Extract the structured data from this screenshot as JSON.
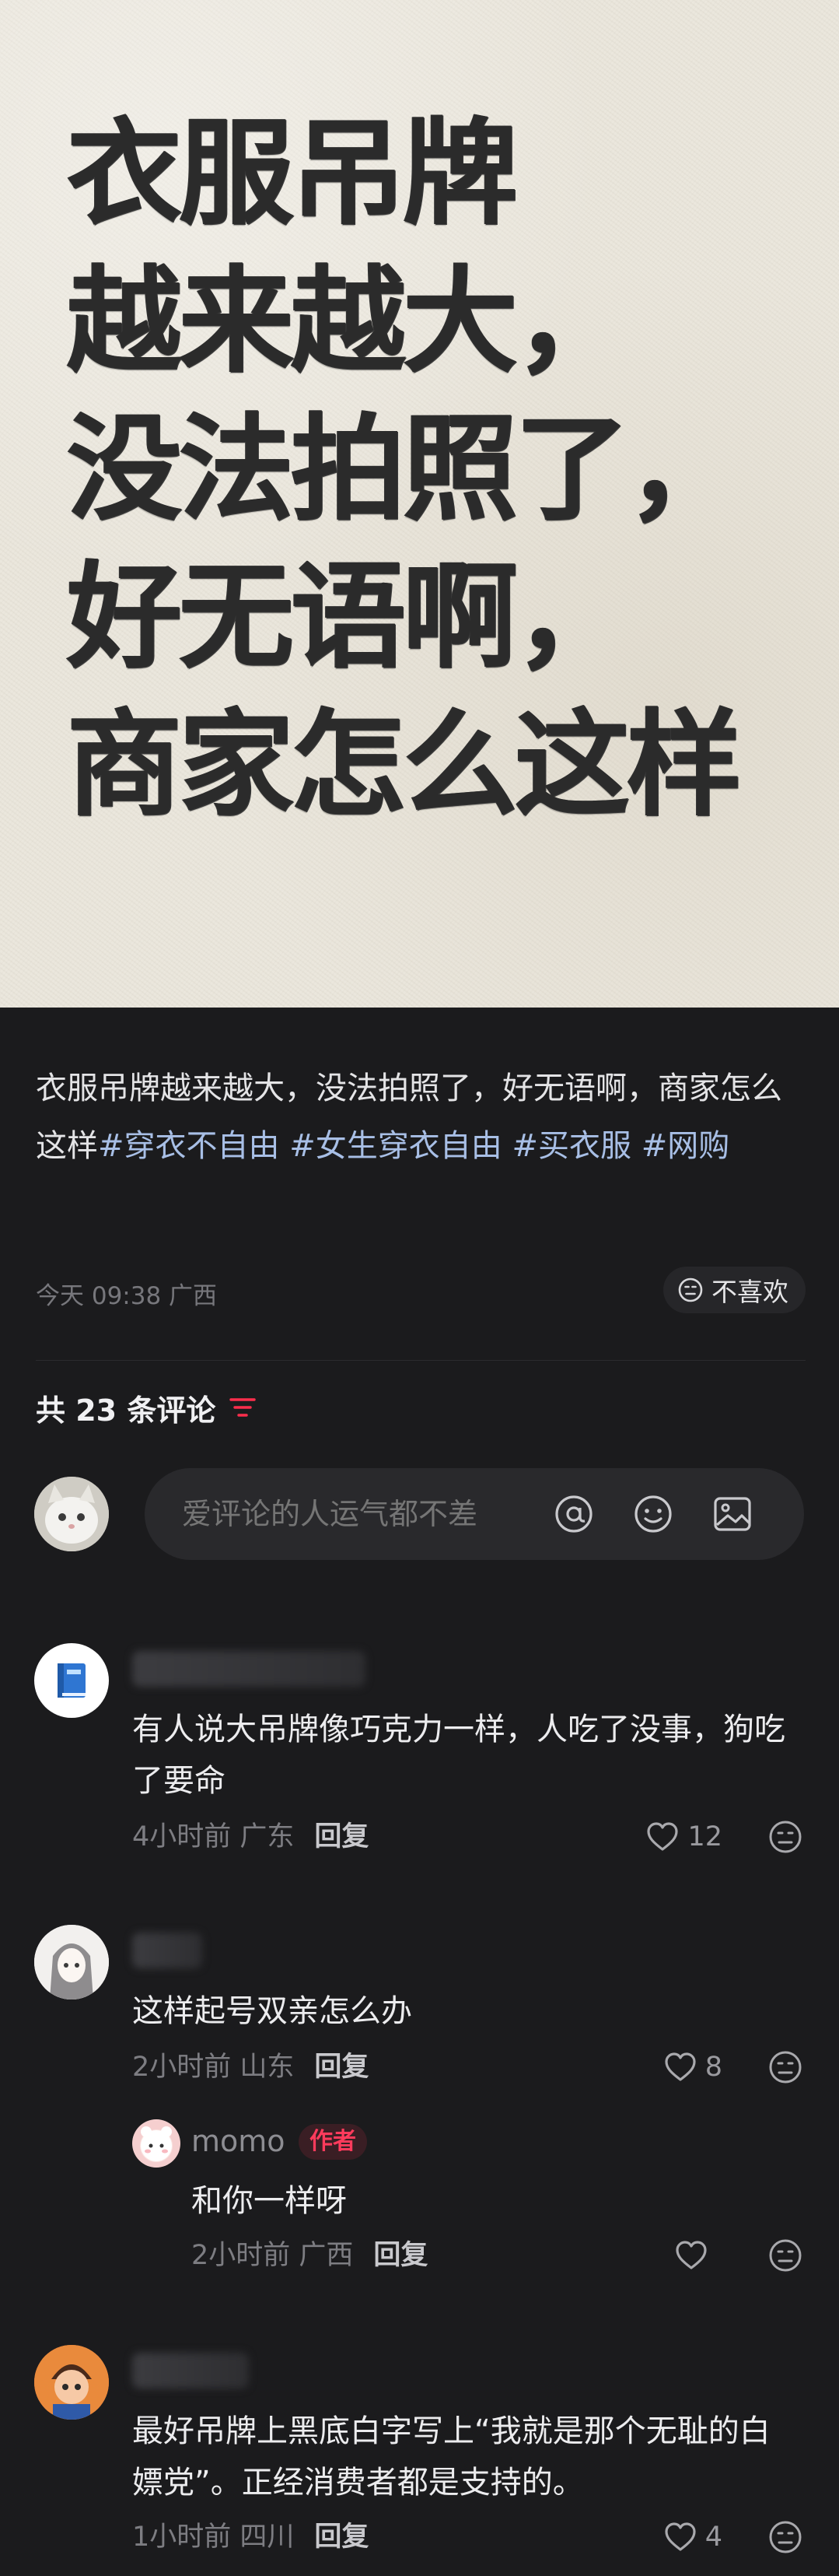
{
  "hero": {
    "lines": [
      "衣服吊牌",
      "越来越大，",
      "没法拍照了，",
      "好无语啊，",
      "商家怎么这样"
    ]
  },
  "post": {
    "text": "衣服吊牌越来越大，没法拍照了，好无语啊，商家怎么这样",
    "tags": [
      "#穿衣不自由",
      "#女生穿衣自由",
      "#买衣服",
      "#网购"
    ],
    "time_location": "今天 09:38 广西",
    "dislike_label": "不喜欢"
  },
  "comments_header": {
    "count_label": "共 23 条评论"
  },
  "composer": {
    "placeholder": "爱评论的人运气都不差"
  },
  "comments": [
    {
      "text": "有人说大吊牌像巧克力一样，人吃了没事，狗吃了要命",
      "time_location": "4小时前 广东",
      "reply_label": "回复",
      "likes": "12"
    },
    {
      "text": "这样起号双亲怎么办",
      "time_location": "2小时前 山东",
      "reply_label": "回复",
      "likes": "8",
      "sub_reply": {
        "author": "momo",
        "badge": "作者",
        "text": "和你一样呀",
        "time_location": "2小时前 广西",
        "reply_label": "回复"
      }
    },
    {
      "text": "最好吊牌上黑底白字写上“我就是那个无耻的白嫖党”。正经消费者都是支持的。",
      "time_location": "1小时前 四川",
      "reply_label": "回复",
      "likes": "4"
    }
  ],
  "colors": {
    "background": "#1b1b1d",
    "hashtag": "#a8bfe6",
    "author_badge": "#ff3b5c",
    "poster_paper": "#eae6dc"
  },
  "icons": [
    "filter-icon",
    "at-icon",
    "emoji-icon",
    "image-icon",
    "heart-icon",
    "dislike-face-icon",
    "book-icon"
  ]
}
